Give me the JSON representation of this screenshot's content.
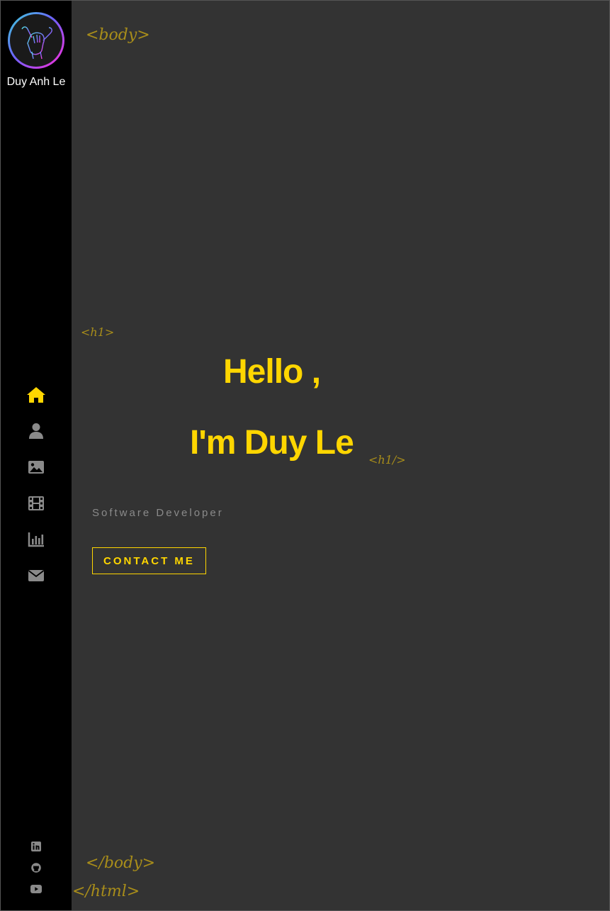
{
  "sidebar": {
    "owner_name": "Duy Anh Le",
    "avatar_icon": "shaka-hand-icon",
    "nav": [
      {
        "icon": "home-icon",
        "active": true
      },
      {
        "icon": "user-icon",
        "active": false
      },
      {
        "icon": "image-icon",
        "active": false
      },
      {
        "icon": "film-icon",
        "active": false
      },
      {
        "icon": "chart-icon",
        "active": false
      },
      {
        "icon": "envelope-icon",
        "active": false
      }
    ],
    "social": [
      {
        "icon": "linkedin-icon"
      },
      {
        "icon": "github-icon"
      },
      {
        "icon": "youtube-icon"
      }
    ]
  },
  "tags": {
    "body_open": "<body>",
    "h1_open": "<h1>",
    "h1_close": "<h1/>",
    "body_close": "</body>",
    "html_close": "</html>"
  },
  "hero": {
    "line1": "Hello ,",
    "line2": "I'm Duy Le",
    "subtitle": "Software Developer",
    "contact_label": "CONTACT ME"
  },
  "colors": {
    "accent": "#ffd600",
    "tag": "#a88d1a",
    "background": "#333333",
    "sidebar": "#000000",
    "icon_inactive": "#8a8a8a"
  }
}
